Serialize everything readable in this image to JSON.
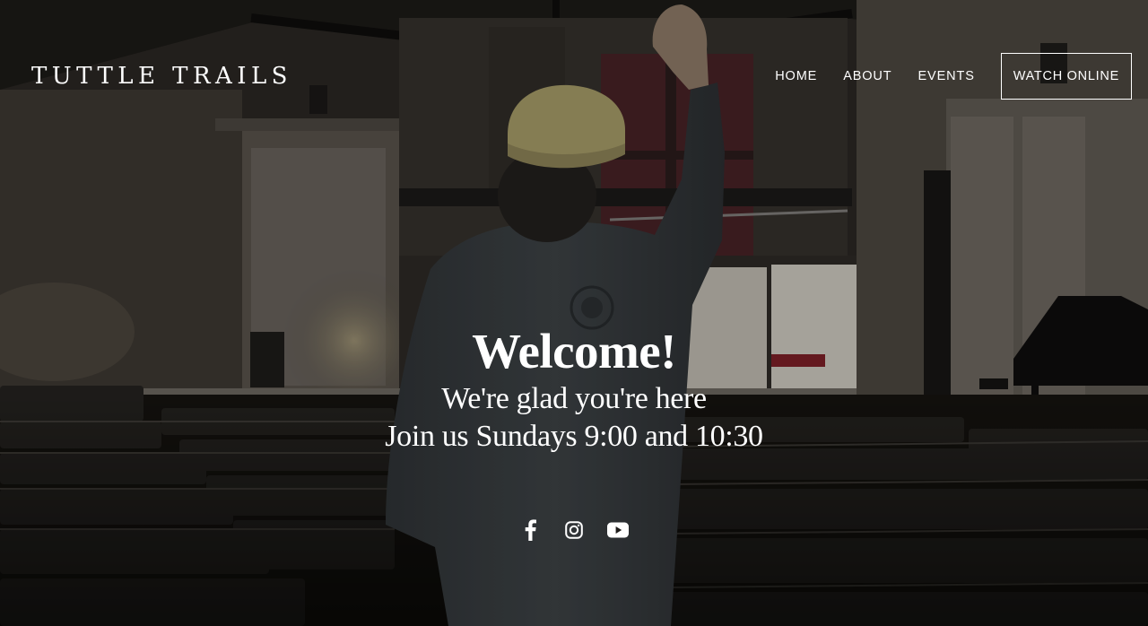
{
  "site": {
    "logo_text": "TUTTLE TRAILS"
  },
  "nav": {
    "items": [
      {
        "label": "HOME"
      },
      {
        "label": "ABOUT"
      },
      {
        "label": "EVENTS"
      }
    ],
    "cta_label": "WATCH ONLINE"
  },
  "hero": {
    "title": "Welcome!",
    "line1": "We're glad you're here",
    "line2": "Join us Sundays 9:00 and 10:30"
  },
  "social": {
    "icons": [
      "facebook-icon",
      "instagram-icon",
      "youtube-icon"
    ]
  },
  "colors": {
    "text": "#ffffff",
    "overlay": "#151413",
    "shirt": "#3b3f42",
    "cap": "#a39966"
  }
}
